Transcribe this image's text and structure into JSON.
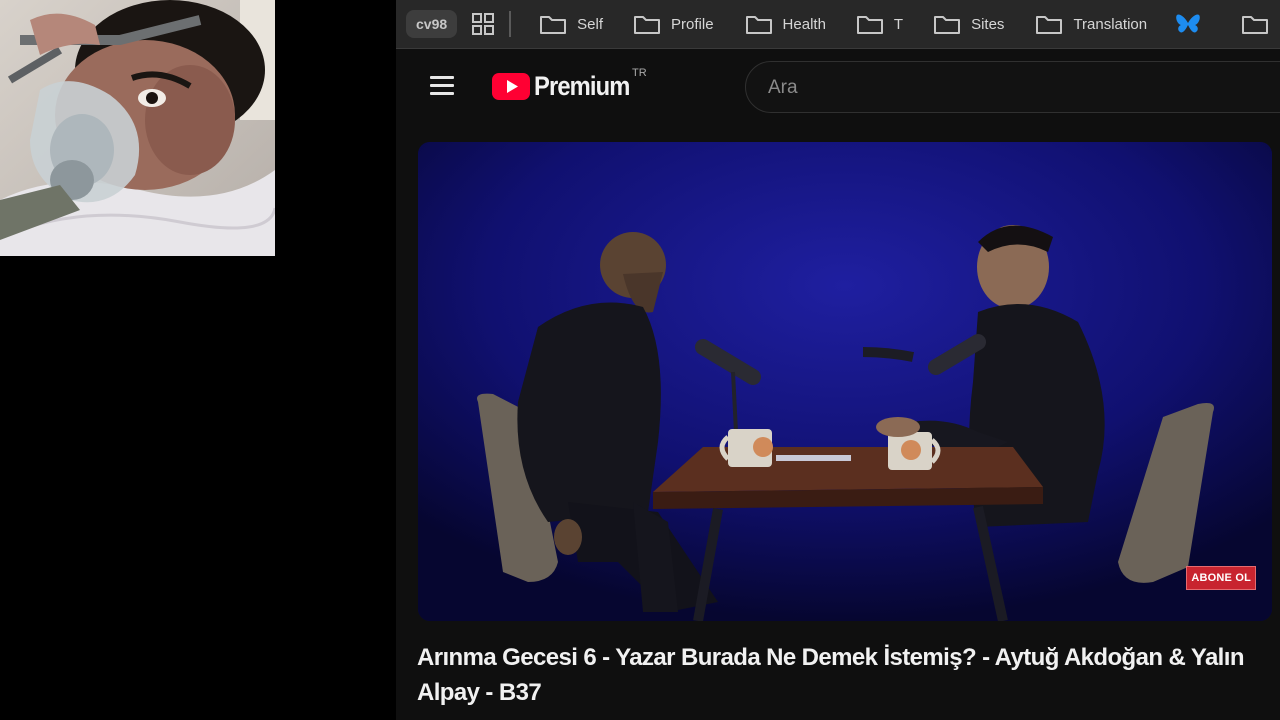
{
  "webcam": {
    "label": "webcam-overlay"
  },
  "bookmarks_bar": {
    "profile_label": "cv98",
    "apps_icon": "grid-icon",
    "items": [
      {
        "label": "Self",
        "icon": "folder-icon"
      },
      {
        "label": "Profile",
        "icon": "folder-icon"
      },
      {
        "label": "Health",
        "icon": "folder-icon"
      },
      {
        "label": "T",
        "icon": "folder-icon"
      },
      {
        "label": "Sites",
        "icon": "folder-icon"
      },
      {
        "label": "Translation",
        "icon": "folder-icon"
      }
    ],
    "bluesky_icon": "butterfly-icon",
    "overflow_icon": "folder-icon"
  },
  "header": {
    "menu_icon": "hamburger-menu-icon",
    "logo_text": "Premium",
    "logo_country": "TR",
    "search_placeholder": "Ara"
  },
  "player": {
    "subscribe_label": "ABONE OL"
  },
  "video": {
    "title": "Arınma Gecesi 6 - Yazar Burada Ne Demek İstemiş? - Aytuğ Akdoğan & Yalın Alpay - B37"
  },
  "colors": {
    "youtube_red": "#ff0033",
    "bluesky_blue": "#1d8cf0",
    "subscribe_red": "#c8242f"
  }
}
